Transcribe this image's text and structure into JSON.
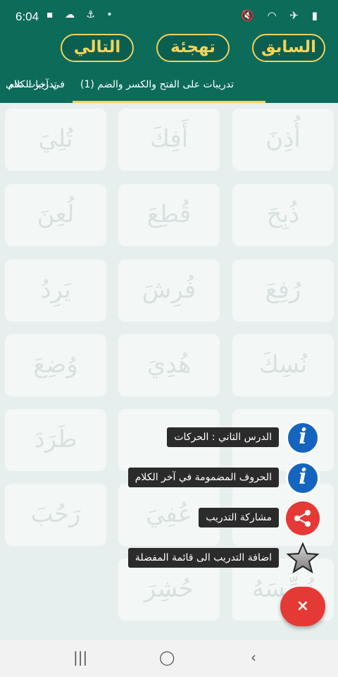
{
  "status": {
    "time": "6:04",
    "left_icons": "▪ ☁ ⚓ •",
    "right_icons": "🔇 ◠ ✈ ▮"
  },
  "header": {
    "prev_label": "السابق",
    "spell_label": "تهجئة",
    "next_label": "التالي"
  },
  "tabs": [
    {
      "label": "في آخر الكلام"
    },
    {
      "label": "تدريبات على الفتح والكسر والضم (1)"
    },
    {
      "label": "تدريبات على"
    }
  ],
  "words": [
    [
      "أُذِنَ",
      "أَفِكَ",
      "تُلِيَ"
    ],
    [
      "ذُبِحَ",
      "قُطِعَ",
      "لُعِنَ"
    ],
    [
      "رُفِعَ",
      "فُرِشَ",
      "يَرِدُ"
    ],
    [
      "نُسِكَ",
      "هُدِيَ",
      "وُضِعَ"
    ],
    [
      "",
      "",
      "طَرَدَ"
    ],
    [
      "",
      "عُفِيَ",
      "رَحُبَ"
    ],
    [
      "نُسِّسَهُ",
      "حُشِرَ",
      ""
    ]
  ],
  "fab_menu": [
    {
      "label": "الدرس الثاني : الحركات",
      "icon": "info-icon",
      "glyph": "i"
    },
    {
      "label": "الحروف المضمومة في آخر الكلام",
      "icon": "info-icon",
      "glyph": "i"
    },
    {
      "label": "مشاركة التدريب",
      "icon": "share-icon",
      "glyph": ""
    },
    {
      "label": "اضافة التدريب الى قائمة المفضلة",
      "icon": "star-icon",
      "glyph": ""
    }
  ],
  "fab_close": "×",
  "nav": {
    "recent": "|||",
    "home": "◯",
    "back": "‹"
  },
  "colors": {
    "primary": "#0d6b5a",
    "accent": "#f3d35a",
    "fab": "#e53935",
    "info": "#1565c0"
  }
}
